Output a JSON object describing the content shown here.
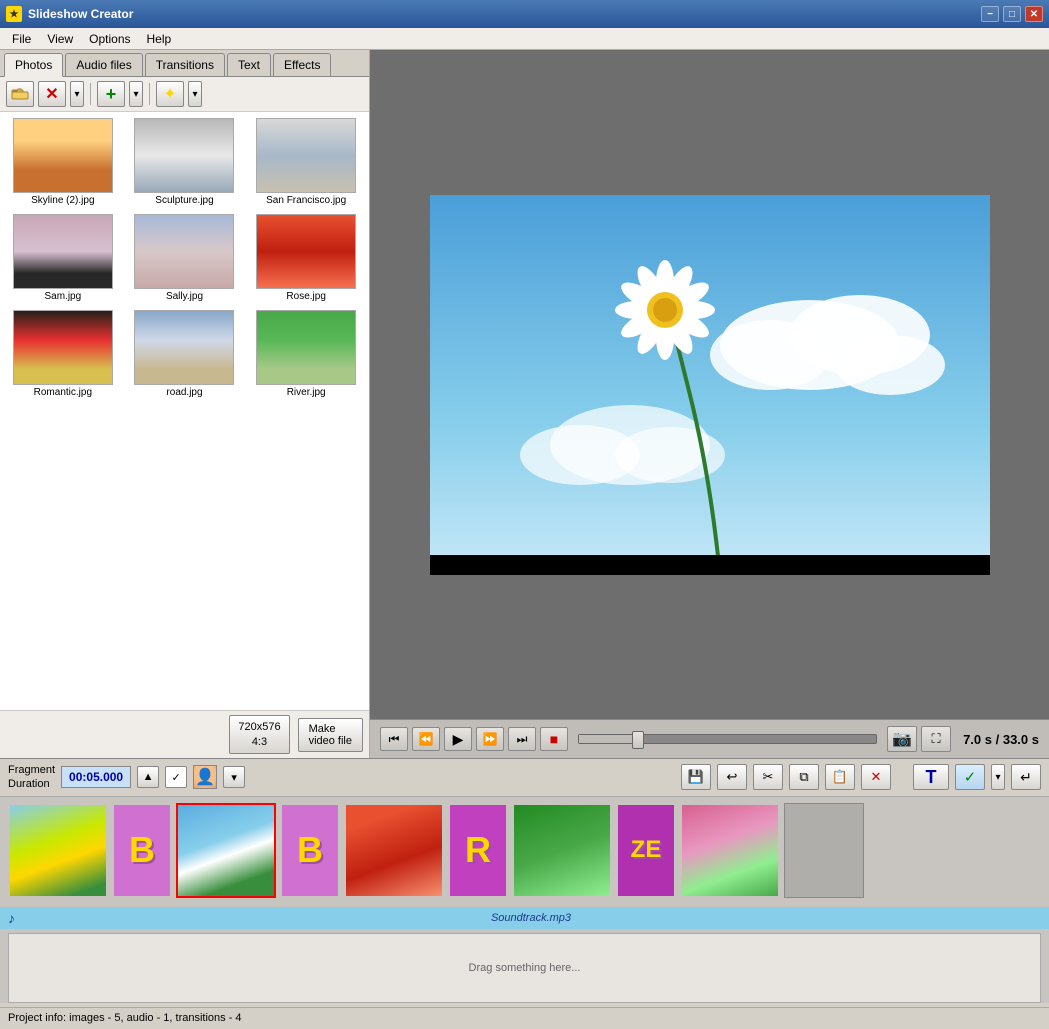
{
  "app": {
    "title": "Slideshow Creator",
    "icon": "★"
  },
  "titlebar": {
    "minimize": "−",
    "maximize": "□",
    "close": "✕"
  },
  "menu": {
    "items": [
      "File",
      "View",
      "Options",
      "Help"
    ]
  },
  "tabs": [
    {
      "label": "Photos",
      "active": true
    },
    {
      "label": "Audio files",
      "active": false
    },
    {
      "label": "Transitions",
      "active": false
    },
    {
      "label": "Text",
      "active": false
    },
    {
      "label": "Effects",
      "active": false
    }
  ],
  "toolbar": {
    "open": "📂",
    "delete": "✕",
    "add": "+",
    "effect": "✦"
  },
  "photos": [
    {
      "name": "Skyline (2).jpg",
      "class": "thumb-skyline"
    },
    {
      "name": "Sculpture.jpg",
      "class": "thumb-sculpture"
    },
    {
      "name": "San Francisco.jpg",
      "class": "thumb-sanfrancisco"
    },
    {
      "name": "Sam.jpg",
      "class": "thumb-sam"
    },
    {
      "name": "Sally.jpg",
      "class": "thumb-sally"
    },
    {
      "name": "Rose.jpg",
      "class": "thumb-rose"
    },
    {
      "name": "Romantic.jpg",
      "class": "thumb-romantic"
    },
    {
      "name": "road.jpg",
      "class": "thumb-road"
    },
    {
      "name": "River.jpg",
      "class": "thumb-river"
    }
  ],
  "size_btn": "720x576\n4:3",
  "make_video_btn": "Make\nvideo file",
  "preview": {
    "time_current": "7.0 s",
    "time_total": "33.0 s",
    "time_separator": " / "
  },
  "controls": {
    "rewind_start": "⏮",
    "rewind": "⏪",
    "play": "▶",
    "forward": "⏩",
    "forward_end": "⏭",
    "stop": "⏹",
    "camera": "📷",
    "fullscreen": "⛶"
  },
  "fragment": {
    "label1": "Fragment",
    "label2": "Duration",
    "time_value": "00:05.000"
  },
  "edit_toolbar": {
    "save": "💾",
    "undo": "↩",
    "cut": "✂",
    "copy": "⧉",
    "paste": "📋",
    "delete": "✕",
    "text_T": "T",
    "check": "✓",
    "arrow_down": "▾",
    "arrow_accept": "↵"
  },
  "timeline": {
    "items": [
      {
        "type": "photo",
        "class": "tl-sunflower",
        "selected": false
      },
      {
        "type": "transition",
        "letter": "B",
        "class": "tl-b1"
      },
      {
        "type": "photo",
        "class": "tl-daisy",
        "selected": true
      },
      {
        "type": "transition",
        "letter": "B",
        "class": "tl-b2"
      },
      {
        "type": "photo",
        "class": "tl-rose",
        "selected": false
      },
      {
        "type": "transition",
        "letter": "R",
        "class": "tl-r1"
      },
      {
        "type": "photo",
        "class": "tl-nature",
        "selected": false
      },
      {
        "type": "transition",
        "letter": "ZE",
        "class": "tl-ze"
      },
      {
        "type": "photo",
        "class": "tl-butterfly",
        "selected": false
      },
      {
        "type": "empty"
      }
    ]
  },
  "soundtrack": {
    "icon": "♪",
    "label": "Soundtrack.mp3"
  },
  "drag_area": {
    "text": "Drag\nsomething here..."
  },
  "statusbar": {
    "text": "Project info: images - 5, audio - 1, transitions - 4"
  }
}
